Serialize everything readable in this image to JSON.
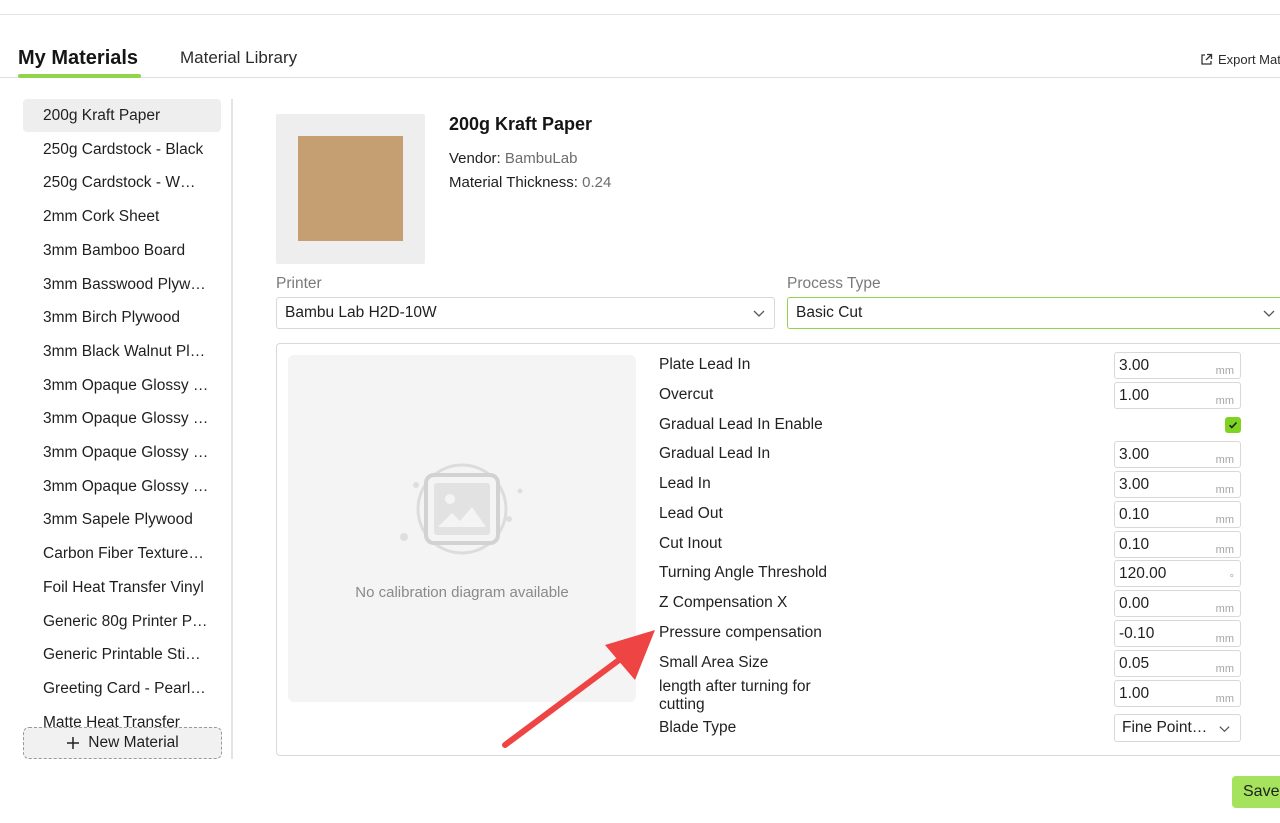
{
  "tabs": {
    "my_materials": "My Materials",
    "material_library": "Material Library",
    "export_label": "Export Mat"
  },
  "materials": [
    "200g Kraft Paper",
    "250g Cardstock - Black",
    "250g Cardstock - W…",
    "2mm Cork Sheet",
    "3mm Bamboo Board",
    "3mm Basswood Plyw…",
    "3mm Birch Plywood",
    "3mm Black Walnut Pl…",
    "3mm Opaque Glossy …",
    "3mm Opaque Glossy …",
    "3mm Opaque Glossy …",
    "3mm Opaque Glossy …",
    "3mm Sapele Plywood",
    "Carbon Fiber Texture…",
    "Foil Heat Transfer Vinyl",
    "Generic 80g Printer P…",
    "Generic Printable Sti…",
    "Greeting Card - Pearl…",
    "Matte Heat Transfer"
  ],
  "new_material_label": "New Material",
  "detail": {
    "title": "200g Kraft Paper",
    "vendor_label": "Vendor:",
    "vendor_value": "BambuLab",
    "thickness_label": "Material Thickness:",
    "thickness_value": "0.24",
    "swatch_color": "#c59f72"
  },
  "printer": {
    "label": "Printer",
    "value": "Bambu Lab H2D-10W"
  },
  "process_type": {
    "label": "Process Type",
    "value": "Basic Cut"
  },
  "diagram_text": "No calibration diagram available",
  "params": [
    {
      "label": "Plate Lead In",
      "value": "3.00",
      "unit": "mm"
    },
    {
      "label": "Overcut",
      "value": "1.00",
      "unit": "mm"
    },
    {
      "label": "Gradual Lead In Enable",
      "checked": true
    },
    {
      "label": "Gradual Lead In",
      "value": "3.00",
      "unit": "mm"
    },
    {
      "label": "Lead In",
      "value": "3.00",
      "unit": "mm"
    },
    {
      "label": "Lead Out",
      "value": "0.10",
      "unit": "mm"
    },
    {
      "label": "Cut Inout",
      "value": "0.10",
      "unit": "mm"
    },
    {
      "label": "Turning Angle Threshold",
      "value": "120.00",
      "unit": "°"
    },
    {
      "label": "Z Compensation X",
      "value": "0.00",
      "unit": "mm"
    },
    {
      "label": "Pressure compensation",
      "value": "-0.10",
      "unit": "mm"
    },
    {
      "label": "Small Area Size",
      "value": "0.05",
      "unit": "mm"
    },
    {
      "label": "length after turning for cutting",
      "value": "1.00",
      "unit": "mm"
    }
  ],
  "blade_type": {
    "label": "Blade Type",
    "value": "Fine Point…"
  },
  "save_label": "Save",
  "colors": {
    "accent": "#8fd44a",
    "save_bg": "#a5e35c",
    "checkbox": "#7ed321",
    "annotation_arrow": "#ee4444"
  }
}
